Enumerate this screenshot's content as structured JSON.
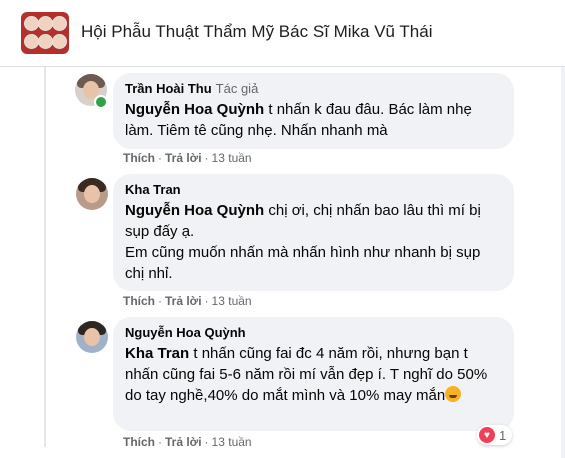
{
  "group": {
    "title": "Hội Phẫu Thuật Thẩm Mỹ Bác Sĩ Mika Vũ Thái"
  },
  "comments": [
    {
      "author": "Trần Hoài Thu",
      "badge": "Tác giả",
      "mention": "Nguyễn Hoa Quỳnh",
      "text": " t nhấn k đau đâu. Bác làm nhẹ làm. Tiêm tê cũng nhẹ. Nhấn nhanh mà",
      "online": true,
      "actions": {
        "like": "Thích",
        "reply": "Trả lời",
        "time": "13 tuần"
      }
    },
    {
      "author": "Kha Tran",
      "mention": "Nguyễn Hoa Quỳnh",
      "text": " chị ơi, chị nhấn bao lâu thì mí bị sụp đấy ạ.",
      "text2": "Em cũng muốn nhấn mà nhấn hình như nhanh bị sụp chị nhỉ.",
      "actions": {
        "like": "Thích",
        "reply": "Trả lời",
        "time": "13 tuần"
      }
    },
    {
      "author": "Nguyễn Hoa Quỳnh",
      "mention": "Kha Tran",
      "text": " t nhấn cũng fai đc 4 năm rồi, nhưng bạn t nhấn cũng fai 5-6 năm rồi mí vẫn đẹp í. T nghĩ do 50% do tay nghề,40% do mắt mình và 10% may mắn",
      "emoji": "laughing-emoji",
      "reaction_count": "1",
      "reaction_icon": "heart-icon",
      "actions": {
        "like": "Thích",
        "reply": "Trả lời",
        "time": "13 tuần"
      }
    }
  ],
  "separator": "·",
  "colors": {
    "bubble": "#f0f2f5",
    "muted": "#65676b",
    "online": "#31a24c",
    "love": "#f33e58"
  }
}
